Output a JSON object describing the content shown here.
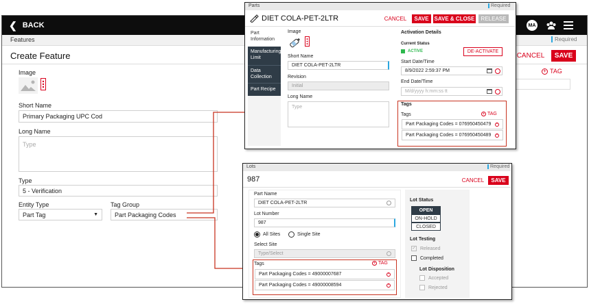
{
  "main": {
    "back": "BACK",
    "avatar": "MA",
    "breadcrumb": "Features",
    "required": "Required",
    "title": "Create Feature",
    "cancel": "CANCEL",
    "save": "SAVE",
    "image_label": "Image",
    "short_name_label": "Short Name",
    "short_name_value": "Primary Packaging UPC Cod",
    "long_name_label": "Long Name",
    "long_name_placeholder": "Type",
    "type_label": "Type",
    "type_value": "5 - Verification",
    "entity_type_label": "Entity Type",
    "entity_type_value": "Part Tag",
    "tag_group_label": "Tag Group",
    "tag_group_value": "Part Packaging Codes",
    "tag_btn": "TAG"
  },
  "parts": {
    "header": "Parts",
    "required": "Required",
    "title": "DIET COLA-PET-2LTR",
    "cancel": "CANCEL",
    "save": "SAVE",
    "save_close": "SAVE & CLOSE",
    "release": "RELEASE",
    "side_tabs": [
      "Part Information",
      "Manufacturing Limit",
      "Data Collection",
      "Part Recipe"
    ],
    "image_label": "Image",
    "short_name_label": "Short Name",
    "short_name_value": "DIET COLA-PET-2LTR",
    "revision_label": "Revision",
    "revision_value": "Initial",
    "long_name_label": "Long Name",
    "long_name_placeholder": "Type",
    "activation_title": "Activation Details",
    "current_status_label": "Current Status",
    "status_value": "ACTIVE",
    "deactivate": "DE-ACTIVATE",
    "start_label": "Start Date/Time",
    "start_value": "8/9/2022 2:59:37 PM",
    "end_label": "End Date/Time",
    "end_placeholder": "M/d/yyyy h:mm:ss tt",
    "tags_title": "Tags",
    "tags_label": "Tags",
    "tag_btn": "TAG",
    "tags": [
      "Part Packaging Codes = 076950450479",
      "Part Packaging Codes = 076950450489"
    ],
    "status_color": "#2db84d"
  },
  "lots": {
    "header": "Lots",
    "required": "Required",
    "title": "987",
    "cancel": "CANCEL",
    "save": "SAVE",
    "part_name_label": "Part Name",
    "part_name_value": "DIET COLA-PET-2LTR",
    "lot_number_label": "Lot Number",
    "lot_number_value": "987",
    "all_sites": "All Sites",
    "single_site": "Single Site",
    "select_site_label": "Select Site",
    "select_site_placeholder": "Type/Select",
    "tags_label": "Tags",
    "tag_btn": "TAG",
    "tags": [
      "Part Packaging Codes = 49000007687",
      "Part Packaging Codes = 49000008594"
    ],
    "lot_status_title": "Lot Status",
    "status_options": [
      "OPEN",
      "ON-HOLD",
      "CLOSED"
    ],
    "lot_testing_title": "Lot Testing",
    "released": "Released",
    "completed": "Completed",
    "lot_disposition_title": "Lot Disposition",
    "accepted": "Accepted",
    "rejected": "Rejected"
  },
  "colors": {
    "brand_red": "#d9001b",
    "link_blue": "#2aa7e0",
    "annotation": "#c8321f"
  }
}
